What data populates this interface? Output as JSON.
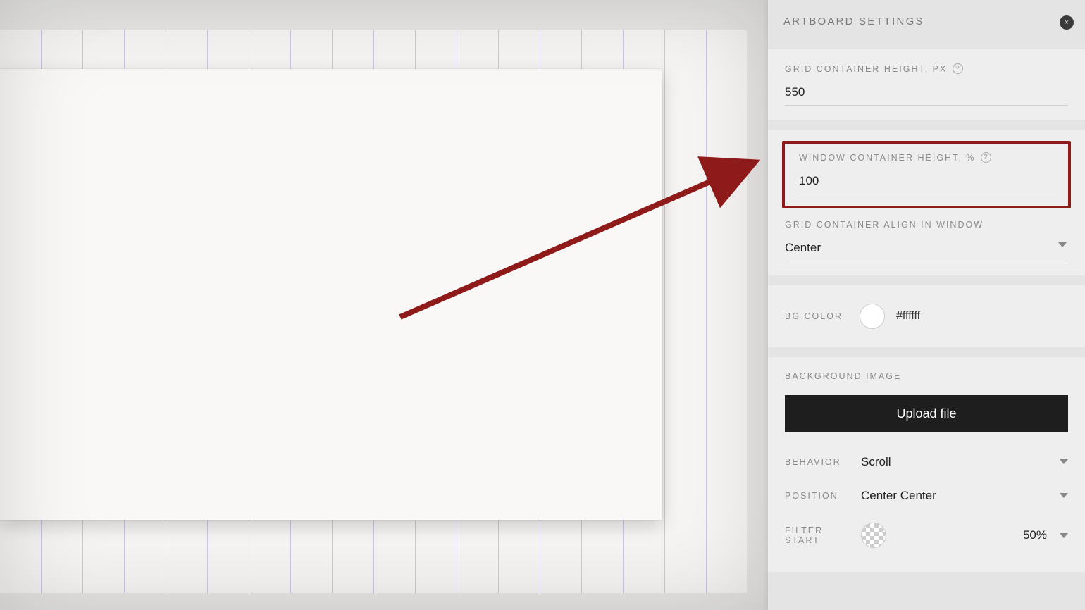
{
  "panel": {
    "title": "ARTBOARD SETTINGS",
    "close_icon": "×"
  },
  "grid_height": {
    "label": "GRID CONTAINER HEIGHT, PX",
    "help": "?",
    "value": "550"
  },
  "window_height": {
    "label": "WINDOW CONTAINER HEIGHT, %",
    "help": "?",
    "value": "100"
  },
  "align": {
    "label": "GRID CONTAINER ALIGN IN WINDOW",
    "value": "Center"
  },
  "bg_color": {
    "label": "BG COLOR",
    "hex": "#ffffff"
  },
  "bg_image": {
    "heading": "BACKGROUND IMAGE",
    "upload_label": "Upload file",
    "behavior_label": "BEHAVIOR",
    "behavior_value": "Scroll",
    "position_label": "POSITION",
    "position_value": "Center Center",
    "filter_label": "FILTER START",
    "filter_value": "50%"
  }
}
